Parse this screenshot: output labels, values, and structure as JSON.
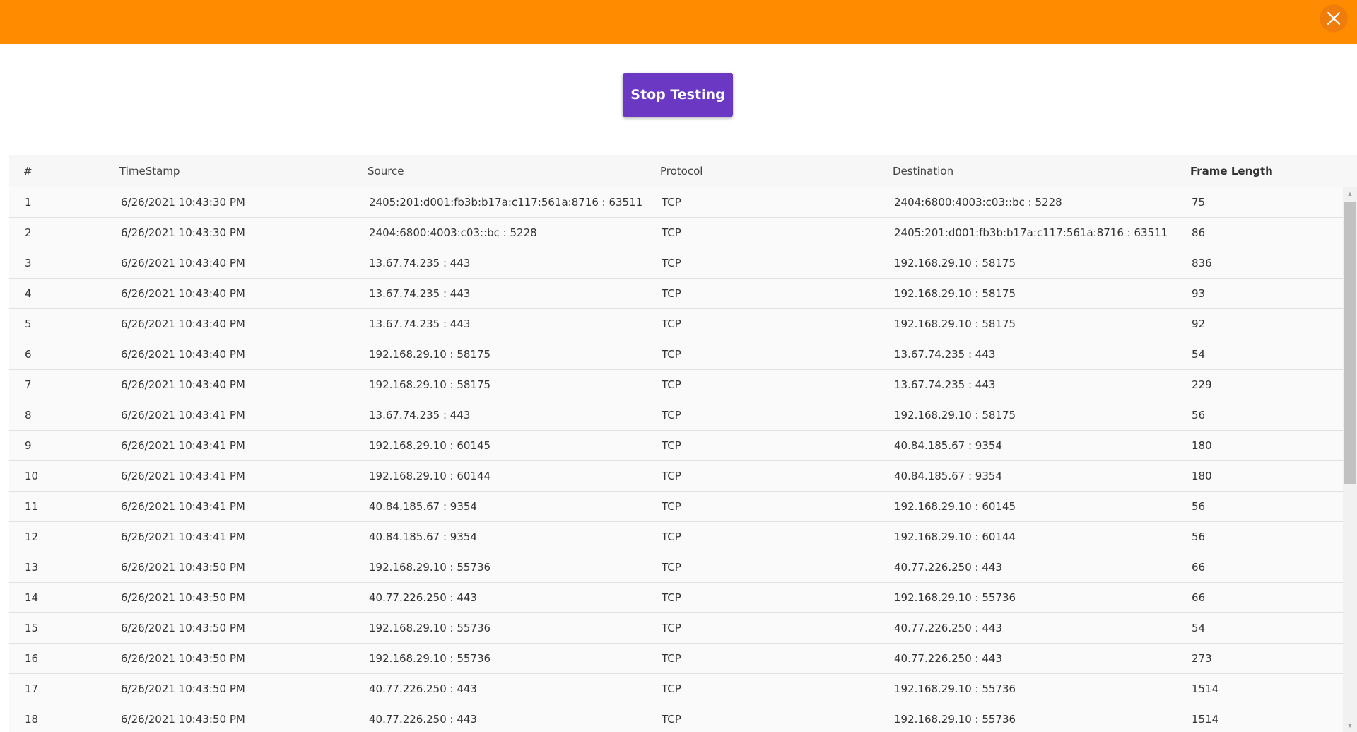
{
  "header": {
    "close_icon": "close-x-icon",
    "accent_color": "#ff8c00"
  },
  "actions": {
    "stop_label": "Stop Testing",
    "button_color": "#6a38c2"
  },
  "table": {
    "headers": [
      "#",
      "TimeStamp",
      "Source",
      "Protocol",
      "Destination",
      "Frame Length"
    ],
    "rows": [
      [
        "1",
        "6/26/2021 10:43:30 PM",
        "2405:201:d001:fb3b:b17a:c117:561a:8716 : 63511",
        "TCP",
        "2404:6800:4003:c03::bc : 5228",
        "75"
      ],
      [
        "2",
        "6/26/2021 10:43:30 PM",
        "2404:6800:4003:c03::bc : 5228",
        "TCP",
        "2405:201:d001:fb3b:b17a:c117:561a:8716 : 63511",
        "86"
      ],
      [
        "3",
        "6/26/2021 10:43:40 PM",
        "13.67.74.235 : 443",
        "TCP",
        "192.168.29.10 : 58175",
        "836"
      ],
      [
        "4",
        "6/26/2021 10:43:40 PM",
        "13.67.74.235 : 443",
        "TCP",
        "192.168.29.10 : 58175",
        "93"
      ],
      [
        "5",
        "6/26/2021 10:43:40 PM",
        "13.67.74.235 : 443",
        "TCP",
        "192.168.29.10 : 58175",
        "92"
      ],
      [
        "6",
        "6/26/2021 10:43:40 PM",
        "192.168.29.10 : 58175",
        "TCP",
        "13.67.74.235 : 443",
        "54"
      ],
      [
        "7",
        "6/26/2021 10:43:40 PM",
        "192.168.29.10 : 58175",
        "TCP",
        "13.67.74.235 : 443",
        "229"
      ],
      [
        "8",
        "6/26/2021 10:43:41 PM",
        "13.67.74.235 : 443",
        "TCP",
        "192.168.29.10 : 58175",
        "56"
      ],
      [
        "9",
        "6/26/2021 10:43:41 PM",
        "192.168.29.10 : 60145",
        "TCP",
        "40.84.185.67 : 9354",
        "180"
      ],
      [
        "10",
        "6/26/2021 10:43:41 PM",
        "192.168.29.10 : 60144",
        "TCP",
        "40.84.185.67 : 9354",
        "180"
      ],
      [
        "11",
        "6/26/2021 10:43:41 PM",
        "40.84.185.67 : 9354",
        "TCP",
        "192.168.29.10 : 60145",
        "56"
      ],
      [
        "12",
        "6/26/2021 10:43:41 PM",
        "40.84.185.67 : 9354",
        "TCP",
        "192.168.29.10 : 60144",
        "56"
      ],
      [
        "13",
        "6/26/2021 10:43:50 PM",
        "192.168.29.10 : 55736",
        "TCP",
        "40.77.226.250 : 443",
        "66"
      ],
      [
        "14",
        "6/26/2021 10:43:50 PM",
        "40.77.226.250 : 443",
        "TCP",
        "192.168.29.10 : 55736",
        "66"
      ],
      [
        "15",
        "6/26/2021 10:43:50 PM",
        "192.168.29.10 : 55736",
        "TCP",
        "40.77.226.250 : 443",
        "54"
      ],
      [
        "16",
        "6/26/2021 10:43:50 PM",
        "192.168.29.10 : 55736",
        "TCP",
        "40.77.226.250 : 443",
        "273"
      ],
      [
        "17",
        "6/26/2021 10:43:50 PM",
        "40.77.226.250 : 443",
        "TCP",
        "192.168.29.10 : 55736",
        "1514"
      ],
      [
        "18",
        "6/26/2021 10:43:50 PM",
        "40.77.226.250 : 443",
        "TCP",
        "192.168.29.10 : 55736",
        "1514"
      ]
    ]
  },
  "scrollbar": {
    "up_icon": "arrow-up-icon",
    "down_icon": "arrow-down-icon"
  }
}
